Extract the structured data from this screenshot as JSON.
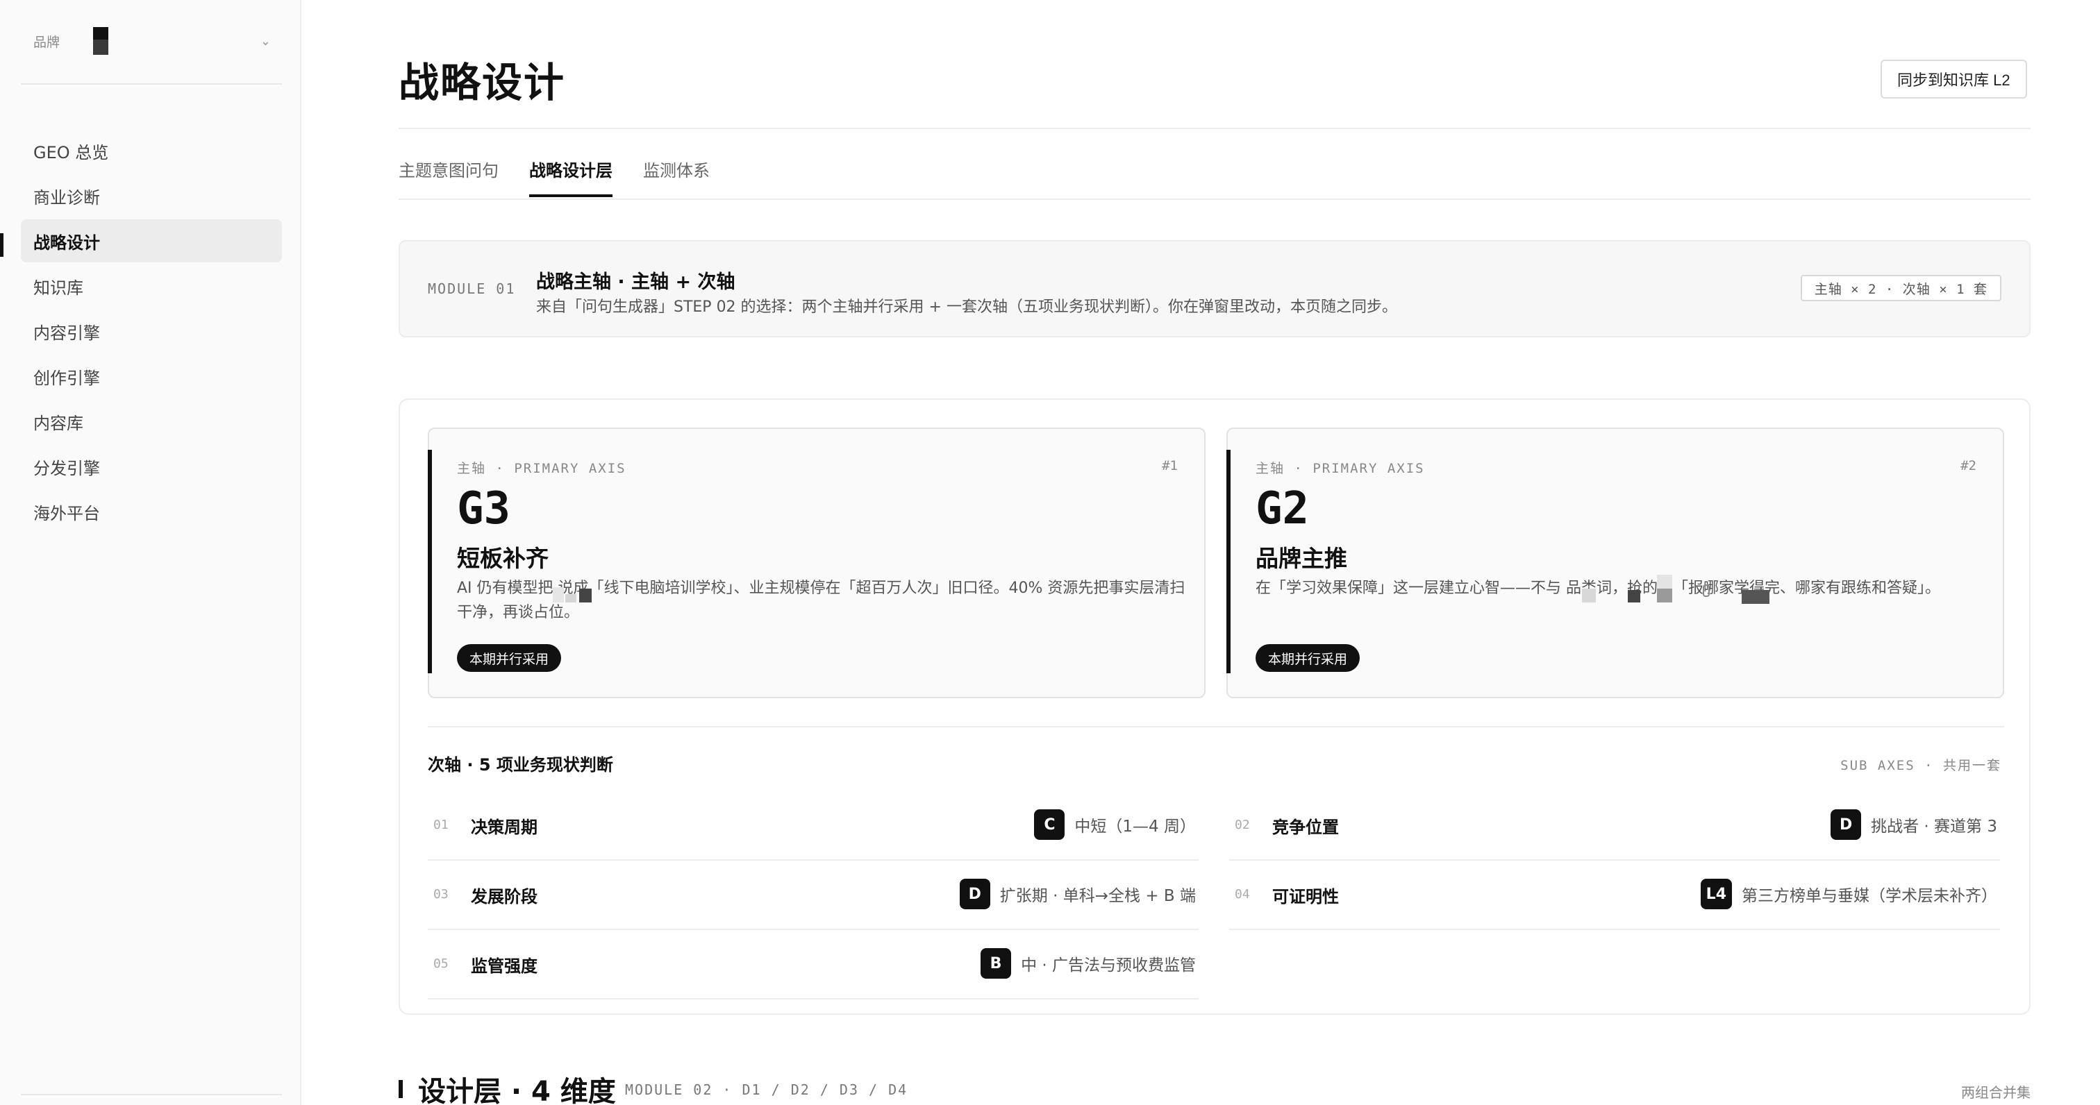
{
  "sidebar": {
    "brand_label": "品牌",
    "items": [
      {
        "label": "GEO 总览"
      },
      {
        "label": "商业诊断"
      },
      {
        "label": "战略设计"
      },
      {
        "label": "知识库"
      },
      {
        "label": "内容引擎"
      },
      {
        "label": "创作引擎"
      },
      {
        "label": "内容库"
      },
      {
        "label": "分发引擎"
      },
      {
        "label": "海外平台"
      }
    ],
    "active_index": 2
  },
  "header": {
    "title": "战略设计",
    "sync_button": "同步到知识库 L2"
  },
  "tabs": [
    {
      "label": "主题意图问句"
    },
    {
      "label": "战略设计层"
    },
    {
      "label": "监测体系"
    }
  ],
  "module1": {
    "tag": "MODULE 01",
    "title": "战略主轴 · 主轴 + 次轴",
    "desc": "来自「问句生成器」STEP 02 的选择：两个主轴并行采用 + 一套次轴（五项业务现状判断）。你在弹窗里改动，本页随之同步。",
    "badge": "主轴 × 2 · 次轴 × 1 套"
  },
  "primary_axes": [
    {
      "kicker": "主轴 · PRIMARY AXIS",
      "num": "#1",
      "code": "G3",
      "name": "短板补齐",
      "desc": "AI 仍有模型把      说成「线下电脑培训学校」、业主规模停在「超百万人次」旧口径。40% 资源先把事实层清扫干净，再谈占位。",
      "pill": "本期并行采用"
    },
    {
      "kicker": "主轴 · PRIMARY AXIS",
      "num": "#2",
      "code": "G2",
      "name": "品牌主推",
      "desc": "在「学习效果保障」这一层建立心智——不与                           品类词，抢的是「报哪家学得完、哪家有跟练和答疑」。",
      "pill": "本期并行采用"
    }
  ],
  "sub_axes": {
    "title": "次轴 · 5 项业务现状判断",
    "meta": "SUB AXES · 共用一套",
    "rows": [
      {
        "idx": "01",
        "label": "决策周期",
        "grade": "C",
        "value": "中短（1—4 周）"
      },
      {
        "idx": "02",
        "label": "竞争位置",
        "grade": "D",
        "value": "挑战者 · 赛道第 3"
      },
      {
        "idx": "03",
        "label": "发展阶段",
        "grade": "D",
        "value": "扩张期 · 单科→全栈 + B 端"
      },
      {
        "idx": "04",
        "label": "可证明性",
        "grade": "L4",
        "value": "第三方榜单与垂媒（学术层未补齐）"
      },
      {
        "idx": "05",
        "label": "监管强度",
        "grade": "B",
        "value": "中 · 广告法与预收费监管"
      }
    ]
  },
  "design_layer": {
    "title": "设计层 · 4 维度",
    "meta": "MODULE 02 · D1 / D2 / D3 / D4",
    "right": "两组合并集"
  }
}
